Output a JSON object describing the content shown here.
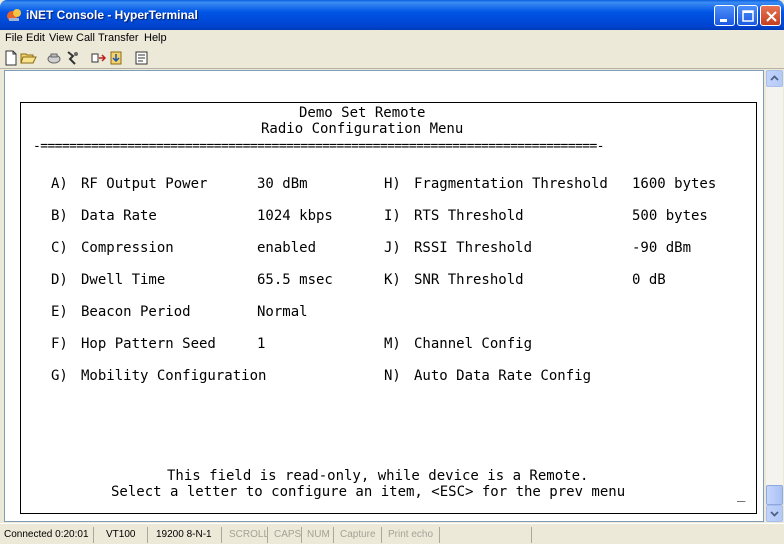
{
  "window": {
    "title": "iNET Console - HyperTerminal",
    "controls": [
      "minimize",
      "maximize",
      "close"
    ]
  },
  "menu": [
    {
      "label": "File",
      "key": "F"
    },
    {
      "label": "Edit",
      "key": "E"
    },
    {
      "label": "View",
      "key": "V"
    },
    {
      "label": "Call",
      "key": "C"
    },
    {
      "label": "Transfer",
      "key": "T"
    },
    {
      "label": "Help",
      "key": "H"
    }
  ],
  "toolbar": [
    "new-icon",
    "open-icon",
    "disconnect-icon",
    "dial-icon",
    "send-icon",
    "receive-icon",
    "properties-icon"
  ],
  "terminal": {
    "title_line1": "Demo Set Remote",
    "title_line2": "Radio Configuration Menu",
    "separator": "-=============================================================================-",
    "left": [
      {
        "key": "A)",
        "label": "RF Output Power",
        "value": "30 dBm"
      },
      {
        "key": "B)",
        "label": "Data Rate",
        "value": "1024 kbps"
      },
      {
        "key": "C)",
        "label": "Compression",
        "value": "enabled"
      },
      {
        "key": "D)",
        "label": "Dwell Time",
        "value": "65.5 msec"
      },
      {
        "key": "E)",
        "label": "Beacon Period",
        "value": "Normal"
      },
      {
        "key": "F)",
        "label": "Hop Pattern Seed",
        "value": "1"
      },
      {
        "key": "G)",
        "label": "Mobility Configuration",
        "value": ""
      }
    ],
    "right": [
      {
        "key": "H)",
        "label": "Fragmentation Threshold",
        "value": "1600 bytes"
      },
      {
        "key": "I)",
        "label": "RTS Threshold",
        "value": "500 bytes"
      },
      {
        "key": "J)",
        "label": "RSSI Threshold",
        "value": "-90 dBm"
      },
      {
        "key": "K)",
        "label": "SNR Threshold",
        "value": "0 dB"
      },
      {
        "key": "",
        "label": "",
        "value": ""
      },
      {
        "key": "M)",
        "label": "Channel Config",
        "value": ""
      },
      {
        "key": "N)",
        "label": "Auto Data Rate Config",
        "value": ""
      }
    ],
    "message_line1": "This field is read-only, while device is a Remote.",
    "message_line2": "Select a letter to configure an item, <ESC> for the prev menu",
    "cursor": "_"
  },
  "status": {
    "connected": "Connected 0:20:01",
    "emulation": "VT100",
    "settings": "19200 8-N-1",
    "scroll": "SCROLL",
    "caps": "CAPS",
    "num": "NUM",
    "capture": "Capture",
    "print_echo": "Print echo"
  }
}
